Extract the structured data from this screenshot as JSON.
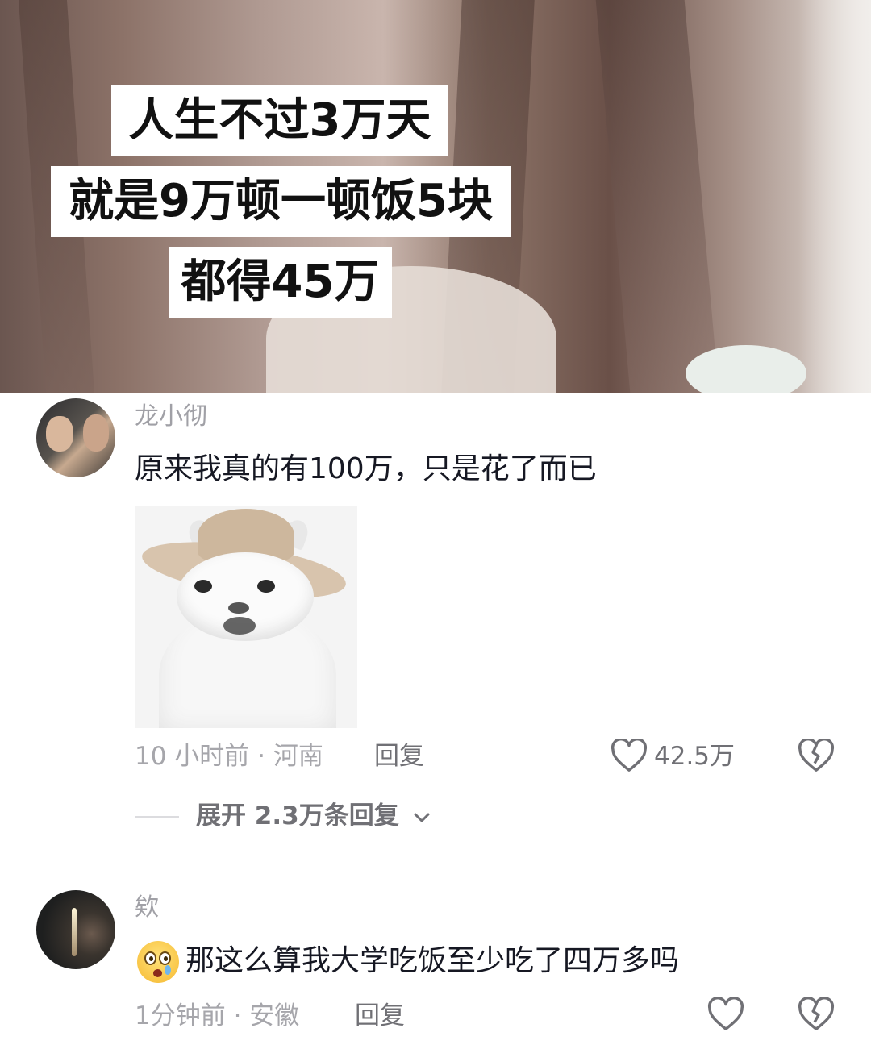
{
  "video": {
    "caption_lines": [
      "人生不过3万天",
      "就是9万顿一顿饭5块",
      "都得45万"
    ]
  },
  "comments": [
    {
      "username": "龙小彻",
      "text": "原来我真的有100万，只是花了而已",
      "sticker": "cat-in-hat-sticker",
      "meta": "10 小时前 · 河南",
      "reply_label": "回复",
      "like_count": "42.5万",
      "expand_label": "展开 2.3万条回复"
    },
    {
      "username": "欸",
      "emoji": "shocked-crying-emoji",
      "text": "那这么算我大学吃饭至少吃了四万多吗",
      "meta": "1分钟前 · 安徽",
      "reply_label": "回复"
    }
  ],
  "icons": {
    "like": "heart-outline-icon",
    "dislike": "broken-heart-icon",
    "expand": "chevron-down-icon"
  },
  "colors": {
    "text_primary": "#161823",
    "text_secondary": "#a6a6ab",
    "action_gray": "#707075"
  }
}
